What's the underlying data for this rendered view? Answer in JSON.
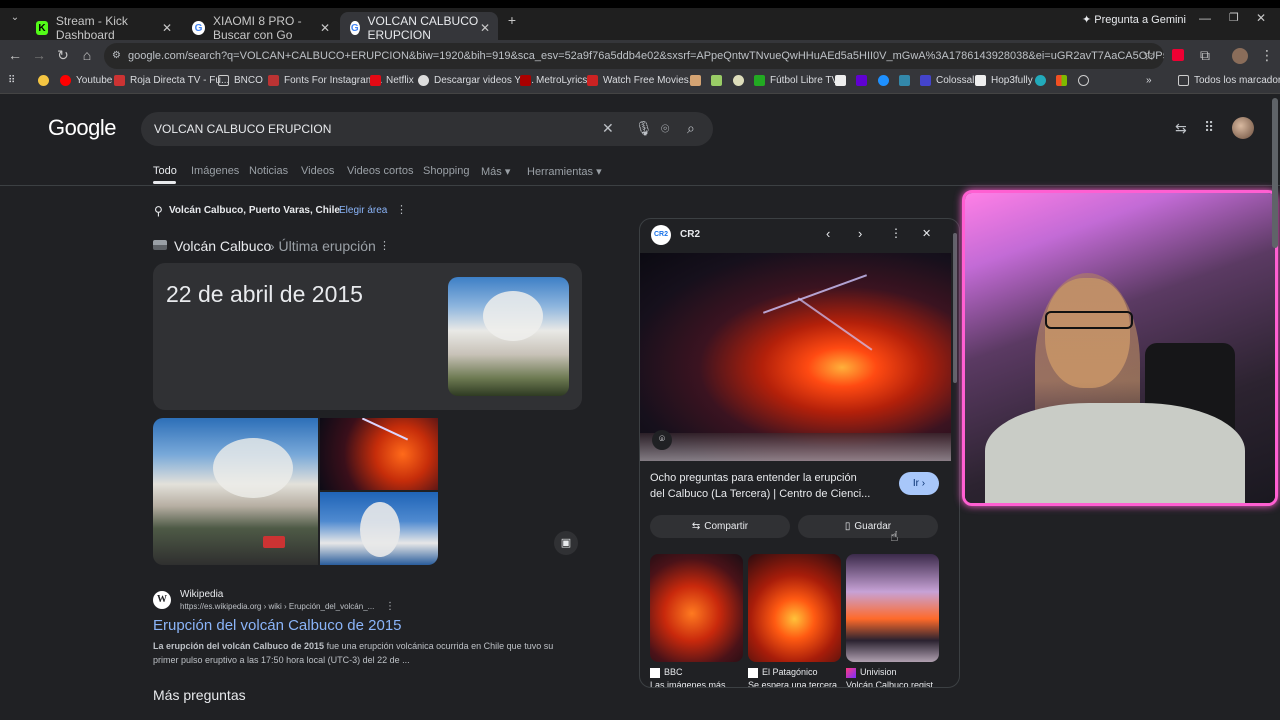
{
  "browser": {
    "tabs": [
      {
        "title": "Stream - Kick Dashboard",
        "favicon": "K"
      },
      {
        "title": "XIAOMI 8 PRO - Buscar con Go",
        "favicon": "G"
      },
      {
        "title": "VOLCAN CALBUCO ERUPCION",
        "favicon": "G"
      }
    ],
    "gemini_label": "Pregunta a Gemini",
    "url": "google.com/search?q=VOLCAN+CALBUCO+ERUPCION&biw=1920&bih=919&sca_esv=52a9f76a5ddb4e02&sxsrf=APpeQntwTNvueQwHHuAEd5a5HII0V_mGwA%3A1786143928038&ei=uGR2avT7AaCA5OUP5p_SqA0&ved=0ahUKEwj0t-TS0I-...",
    "bookmarks": [
      "Youtube",
      "Roja Directa TV - Fu...",
      "BNCO",
      "Fonts For Instagram...",
      "Netflix",
      "Descargar videos Yo...",
      "MetroLyrics",
      "Watch Free Movies...",
      "Fútbol Libre TV",
      "Colossal",
      "Hop3fully"
    ],
    "all_bookmarks": "Todos los marcadores"
  },
  "google": {
    "logo": "Google",
    "query": "VOLCAN CALBUCO ERUPCION",
    "tabs": [
      "Todo",
      "Imágenes",
      "Noticias",
      "Videos",
      "Videos cortos",
      "Shopping",
      "Más",
      "Herramientas"
    ]
  },
  "results": {
    "location": "Volcán Calbuco, Puerto Varas, Chile",
    "choose_area": "Elegir área",
    "breadcrumb_main": "Volcán Calbuco",
    "breadcrumb_sub": "› Última erupción",
    "answer": "22 de abril de 2015",
    "wiki_source": "Wikipedia",
    "wiki_url": "https://es.wikipedia.org › wiki › Erupción_del_volcán_...",
    "wiki_title": "Erupción del volcán Calbuco de 2015",
    "wiki_snippet_bold": "La erupción del volcán Calbuco de 2015",
    "wiki_snippet_1": " fue una erupción volcánica ocurrida en Chile que tuvo su",
    "wiki_snippet_2": "primer pulso eruptivo a las 17:50 hora local (UTC-3) del 22 de ...",
    "more_questions": "Más preguntas"
  },
  "panel": {
    "source": "CR2",
    "caption_1": "Ocho preguntas para entender la erupción",
    "caption_2": "del Calbuco (La Tercera) | Centro de Cienci...",
    "go_label": "Ir",
    "share_label": "Compartir",
    "save_label": "Guardar",
    "related": [
      {
        "source": "BBC",
        "title": "Las imágenes más"
      },
      {
        "source": "El Patagónico",
        "title": "Se espera una tercera"
      },
      {
        "source": "Univision",
        "title": "Volcán Calbuco regist"
      }
    ]
  }
}
